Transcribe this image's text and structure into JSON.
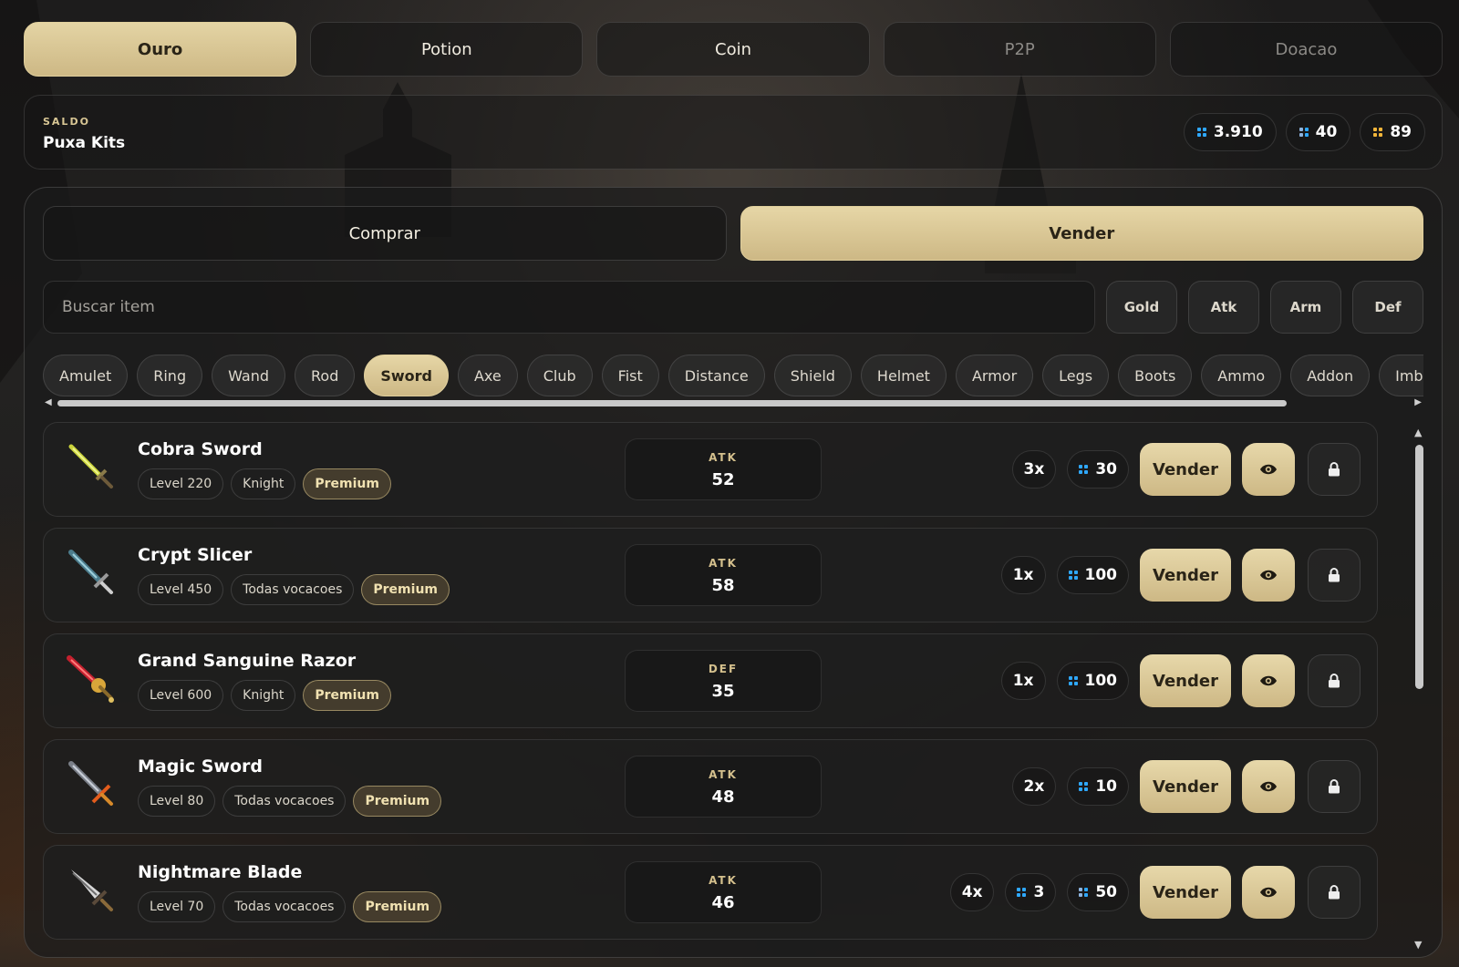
{
  "top_tabs": [
    {
      "label": "Ouro"
    },
    {
      "label": "Potion"
    },
    {
      "label": "Coin"
    },
    {
      "label": "P2P"
    },
    {
      "label": "Doacao"
    }
  ],
  "balance": {
    "label": "SALDO",
    "name": "Puxa Kits",
    "currencies": [
      {
        "value": "3.910",
        "icon": "blue-gem-icon"
      },
      {
        "value": "40",
        "icon": "blue-gem-icon"
      },
      {
        "value": "89",
        "icon": "gold-gem-icon"
      }
    ]
  },
  "mode_tabs": [
    {
      "label": "Comprar"
    },
    {
      "label": "Vender"
    }
  ],
  "search": {
    "placeholder": "Buscar item"
  },
  "stat_filters": [
    "Gold",
    "Atk",
    "Arm",
    "Def"
  ],
  "categories": [
    "Amulet",
    "Ring",
    "Wand",
    "Rod",
    "Sword",
    "Axe",
    "Club",
    "Fist",
    "Distance",
    "Shield",
    "Helmet",
    "Armor",
    "Legs",
    "Boots",
    "Ammo",
    "Addon",
    "Imbuement"
  ],
  "active_category": "Sword",
  "items": [
    {
      "name": "Cobra Sword",
      "level": "Level 220",
      "vocation": "Knight",
      "tier": "Premium",
      "stat_key": "ATK",
      "stat_value": "52",
      "qty": "3x",
      "prices": [
        "30"
      ],
      "action": "Vender"
    },
    {
      "name": "Crypt Slicer",
      "level": "Level 450",
      "vocation": "Todas vocacoes",
      "tier": "Premium",
      "stat_key": "ATK",
      "stat_value": "58",
      "qty": "1x",
      "prices": [
        "100"
      ],
      "action": "Vender"
    },
    {
      "name": "Grand Sanguine Razor",
      "level": "Level 600",
      "vocation": "Knight",
      "tier": "Premium",
      "stat_key": "DEF",
      "stat_value": "35",
      "qty": "1x",
      "prices": [
        "100"
      ],
      "action": "Vender"
    },
    {
      "name": "Magic Sword",
      "level": "Level 80",
      "vocation": "Todas vocacoes",
      "tier": "Premium",
      "stat_key": "ATK",
      "stat_value": "48",
      "qty": "2x",
      "prices": [
        "10"
      ],
      "action": "Vender"
    },
    {
      "name": "Nightmare Blade",
      "level": "Level 70",
      "vocation": "Todas vocacoes",
      "tier": "Premium",
      "stat_key": "ATK",
      "stat_value": "46",
      "qty": "4x",
      "prices": [
        "3",
        "50"
      ],
      "action": "Vender"
    }
  ],
  "colors": {
    "accent": "#d8c593",
    "accent_text": "#2a2417",
    "panel": "#1e1e1e",
    "gem_blue": "#2fa8ff",
    "gem_gold": "#f1b53a"
  }
}
